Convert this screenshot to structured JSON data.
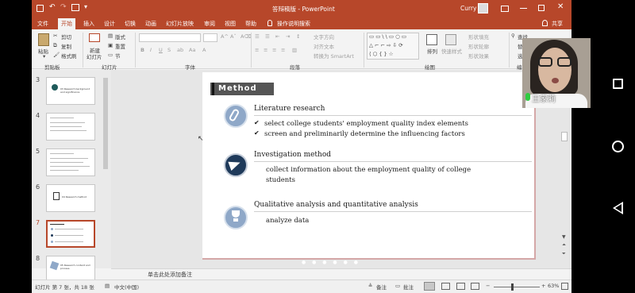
{
  "titlebar": {
    "doc_title": "答辩稿版 - PowerPoint",
    "user": "Curry"
  },
  "ribbon_tabs": [
    "文件",
    "开始",
    "插入",
    "设计",
    "切换",
    "动画",
    "幻灯片放映",
    "审阅",
    "视图",
    "帮助"
  ],
  "tell_me": "操作说明搜索",
  "share": "共享",
  "ribbon": {
    "clipboard": {
      "paste": "粘贴",
      "cut": "剪切",
      "copy": "复制",
      "format_painter": "格式刷",
      "group": "剪贴板"
    },
    "slides": {
      "new_slide": "新建",
      "new_slide2": "幻灯片",
      "layout": "版式",
      "reset": "重置",
      "section": "节",
      "group": "幻灯片"
    },
    "font": {
      "group": "字体"
    },
    "paragraph": {
      "text_direction": "文字方向",
      "align_text": "对齐文本",
      "convert_smartart": "转换为 SmartArt",
      "group": "段落"
    },
    "drawing": {
      "arrange": "排列",
      "quick_styles": "快速样式",
      "shape_fill": "形状填充",
      "shape_outline": "形状轮廓",
      "shape_effects": "形状效果",
      "group": "绘图"
    },
    "editing": {
      "find": "查找",
      "replace": "替",
      "select": "选",
      "group": "编辑"
    }
  },
  "thumbnails": [
    {
      "num": "3",
      "title": "03  Research background and significance"
    },
    {
      "num": "4",
      "title": ""
    },
    {
      "num": "5",
      "title": ""
    },
    {
      "num": "6",
      "title": "04  Research method"
    },
    {
      "num": "7",
      "title": ""
    },
    {
      "num": "8",
      "title": "05  Research content and process"
    }
  ],
  "slide": {
    "heading": "Method",
    "sections": [
      {
        "title": "Literature research",
        "bullets": [
          "select college students' employment quality index elements",
          "screen and preliminarily determine the influencing factors"
        ]
      },
      {
        "title": "Investigation method",
        "body1": "collect information about the employment quality of college",
        "body2": "students"
      },
      {
        "title": "Qualitative analysis and quantitative analysis",
        "body1": "analyze data"
      }
    ]
  },
  "notes_placeholder": "单击此处添加备注",
  "status": {
    "slide_info": "幻灯片 第 7 张，共 18 张",
    "language": "中文(中国)",
    "notes": "备注",
    "comments": "批注",
    "zoom": "63%"
  },
  "participant": {
    "name": "王家莉"
  },
  "colors": {
    "accent": "#b7472a",
    "icon_blue": "#8fa8c8",
    "icon_dark": "#1f3a5a"
  },
  "icons": [
    "back-icon",
    "home-icon",
    "recent-apps-icon",
    "paperclip-icon",
    "paper-plane-icon",
    "trophy-icon",
    "microphone-icon"
  ]
}
